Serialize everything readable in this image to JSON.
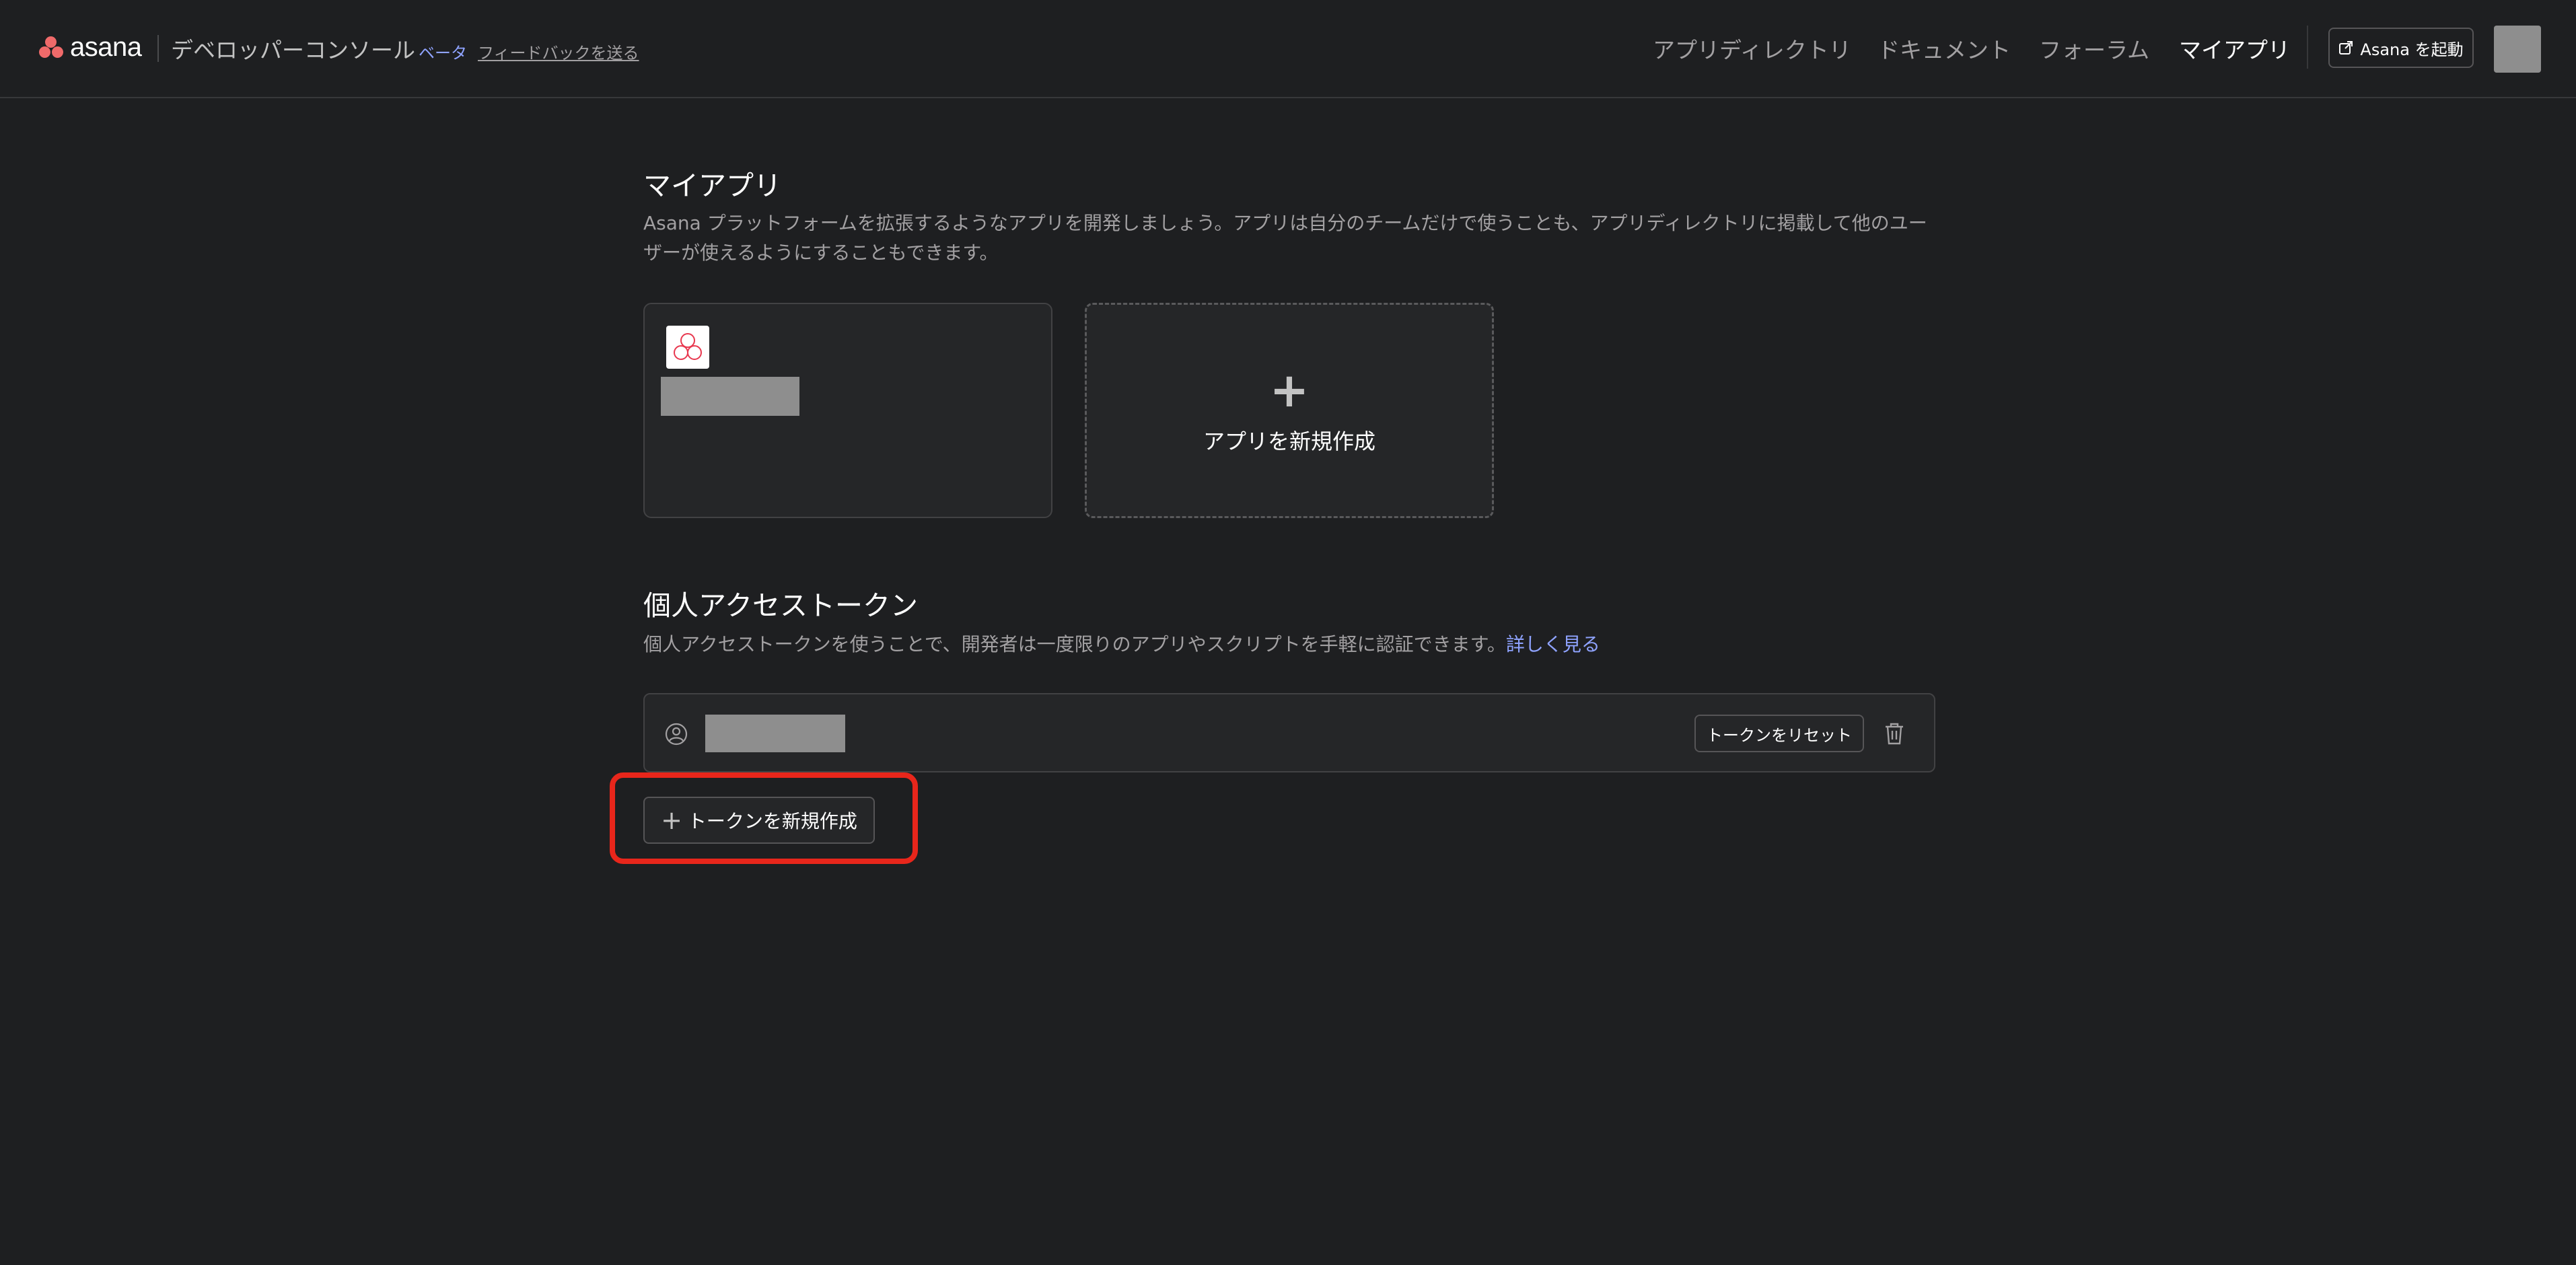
{
  "header": {
    "logo_text": "asana",
    "console_title": "デベロッパーコンソール",
    "beta_label": "ベータ",
    "feedback_link": "フィードバックを送る",
    "nav": [
      {
        "label": "アプリディレクトリ",
        "active": false
      },
      {
        "label": "ドキュメント",
        "active": false
      },
      {
        "label": "フォーラム",
        "active": false
      },
      {
        "label": "マイアプリ",
        "active": true
      }
    ],
    "launch_button": "Asana を起動"
  },
  "my_apps": {
    "title": "マイアプリ",
    "description": "Asana プラットフォームを拡張するようなアプリを開発しましょう。アプリは自分のチームだけで使うことも、アプリディレクトリに掲載して他のユーザーが使えるようにすることもできます。",
    "new_app_label": "アプリを新規作成"
  },
  "tokens": {
    "title": "個人アクセストークン",
    "description": "個人アクセストークンを使うことで、開発者は一度限りのアプリやスクリプトを手軽に認証できます。",
    "learn_more": "詳しく見る",
    "reset_button": "トークンをリセット",
    "new_token_button": "トークンを新規作成"
  },
  "colors": {
    "background": "#1e1f21",
    "card": "#252628",
    "accent_link": "#8fa3ff",
    "brand_coral": "#f06a6a",
    "highlight": "#e8261b"
  }
}
